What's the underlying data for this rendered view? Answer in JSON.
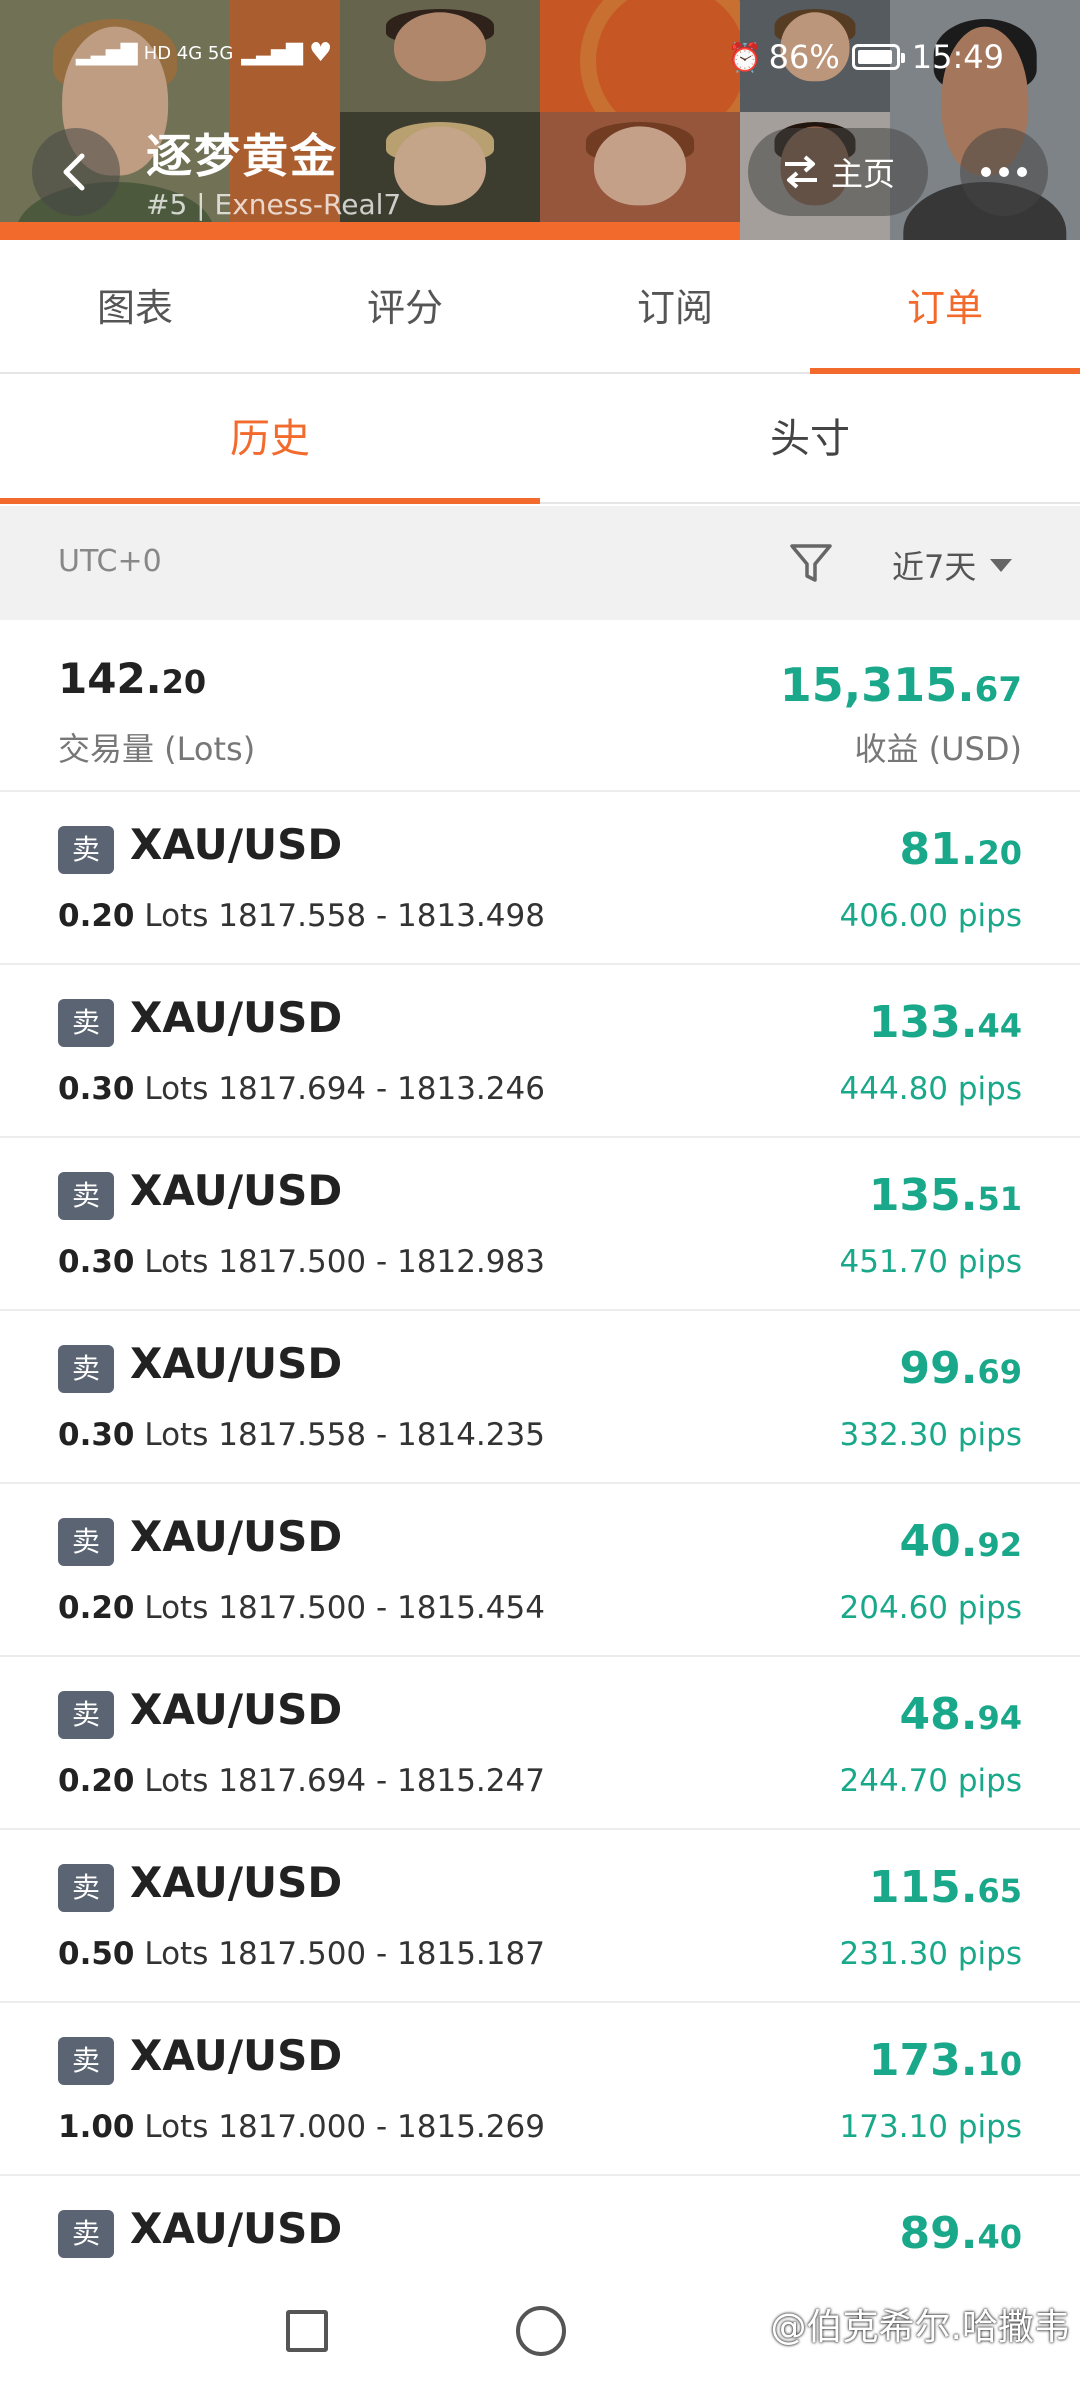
{
  "status_bar": {
    "left_text": "HD 4G 5G",
    "battery": "86%",
    "time": "15:49"
  },
  "header": {
    "title": "逐梦黄金",
    "subtitle": "#5 | Exness-Real7",
    "home_label": "主页"
  },
  "main_tabs": [
    "图表",
    "评分",
    "订阅",
    "订单"
  ],
  "sub_tabs": [
    "历史",
    "头寸"
  ],
  "filter": {
    "timezone": "UTC+0",
    "range": "近7天"
  },
  "summary": {
    "lots_int": "142.",
    "lots_dec": "20",
    "lots_label": "交易量 (Lots)",
    "profit_int": "15,315.",
    "profit_dec": "67",
    "profit_label": "收益 (USD)"
  },
  "orders": [
    {
      "side": "卖",
      "symbol": "XAU/USD",
      "lots": "0.20",
      "lots_unit": "Lots",
      "range": "1817.558 - 1813.498",
      "profit_int": "81.",
      "profit_dec": "20",
      "pips": "406.00 pips"
    },
    {
      "side": "卖",
      "symbol": "XAU/USD",
      "lots": "0.30",
      "lots_unit": "Lots",
      "range": "1817.694 - 1813.246",
      "profit_int": "133.",
      "profit_dec": "44",
      "pips": "444.80 pips"
    },
    {
      "side": "卖",
      "symbol": "XAU/USD",
      "lots": "0.30",
      "lots_unit": "Lots",
      "range": "1817.500 - 1812.983",
      "profit_int": "135.",
      "profit_dec": "51",
      "pips": "451.70 pips"
    },
    {
      "side": "卖",
      "symbol": "XAU/USD",
      "lots": "0.30",
      "lots_unit": "Lots",
      "range": "1817.558 - 1814.235",
      "profit_int": "99.",
      "profit_dec": "69",
      "pips": "332.30 pips"
    },
    {
      "side": "卖",
      "symbol": "XAU/USD",
      "lots": "0.20",
      "lots_unit": "Lots",
      "range": "1817.500 - 1815.454",
      "profit_int": "40.",
      "profit_dec": "92",
      "pips": "204.60 pips"
    },
    {
      "side": "卖",
      "symbol": "XAU/USD",
      "lots": "0.20",
      "lots_unit": "Lots",
      "range": "1817.694 - 1815.247",
      "profit_int": "48.",
      "profit_dec": "94",
      "pips": "244.70 pips"
    },
    {
      "side": "卖",
      "symbol": "XAU/USD",
      "lots": "0.50",
      "lots_unit": "Lots",
      "range": "1817.500 - 1815.187",
      "profit_int": "115.",
      "profit_dec": "65",
      "pips": "231.30 pips"
    },
    {
      "side": "卖",
      "symbol": "XAU/USD",
      "lots": "1.00",
      "lots_unit": "Lots",
      "range": "1817.000 - 1815.269",
      "profit_int": "173.",
      "profit_dec": "10",
      "pips": "173.10 pips"
    },
    {
      "side": "卖",
      "symbol": "XAU/USD",
      "lots": "",
      "lots_unit": "",
      "range": "",
      "profit_int": "89.",
      "profit_dec": "40",
      "pips": ""
    }
  ],
  "watermark": "@伯克希尔.哈撒韦",
  "colors": {
    "accent": "#f26b2c",
    "profit": "#1aa88a",
    "sell_badge": "#5b6472"
  }
}
